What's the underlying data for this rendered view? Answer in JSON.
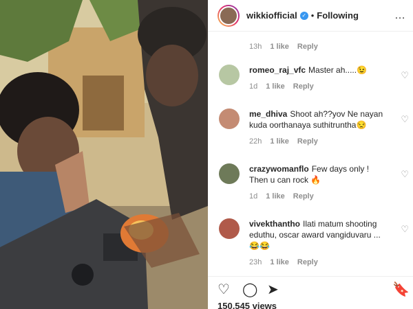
{
  "post": {
    "username": "wikkiofficial",
    "follow_status": "Following",
    "separator": "•",
    "views": "150,545 views"
  },
  "first_meta": {
    "time": "13h",
    "likes": "1 like",
    "reply": "Reply"
  },
  "comments": [
    {
      "user": "romeo_raj_vfc",
      "text": "Master ah.....😉",
      "time": "1d",
      "likes": "1 like",
      "reply": "Reply",
      "avatar_color": "#b7c7a3"
    },
    {
      "user": "me_dhiva",
      "text": "Shoot ah??yov Ne nayan kuda oorthanaya suthitruntha😒",
      "time": "22h",
      "likes": "1 like",
      "reply": "Reply",
      "avatar_color": "#c48b73"
    },
    {
      "user": "crazywomanflo",
      "text": "Few days only ! Then u can rock 🔥",
      "time": "1d",
      "likes": "1 like",
      "reply": "Reply",
      "avatar_color": "#6e7a59"
    },
    {
      "user": "vivekthantho",
      "text": "Ilati matum shooting eduthu, oscar award vangiduvaru ... 😂😂",
      "time": "23h",
      "likes": "1 like",
      "reply": "Reply",
      "avatar_color": "#b05a4a"
    }
  ],
  "icons": {
    "more": "…",
    "like": "♡",
    "comment": "◯",
    "share": "➤",
    "save": "🔖",
    "heart": "♡"
  },
  "colors": {
    "verified": "#3897f0",
    "text": "#262626",
    "muted": "#8e8e8e"
  }
}
